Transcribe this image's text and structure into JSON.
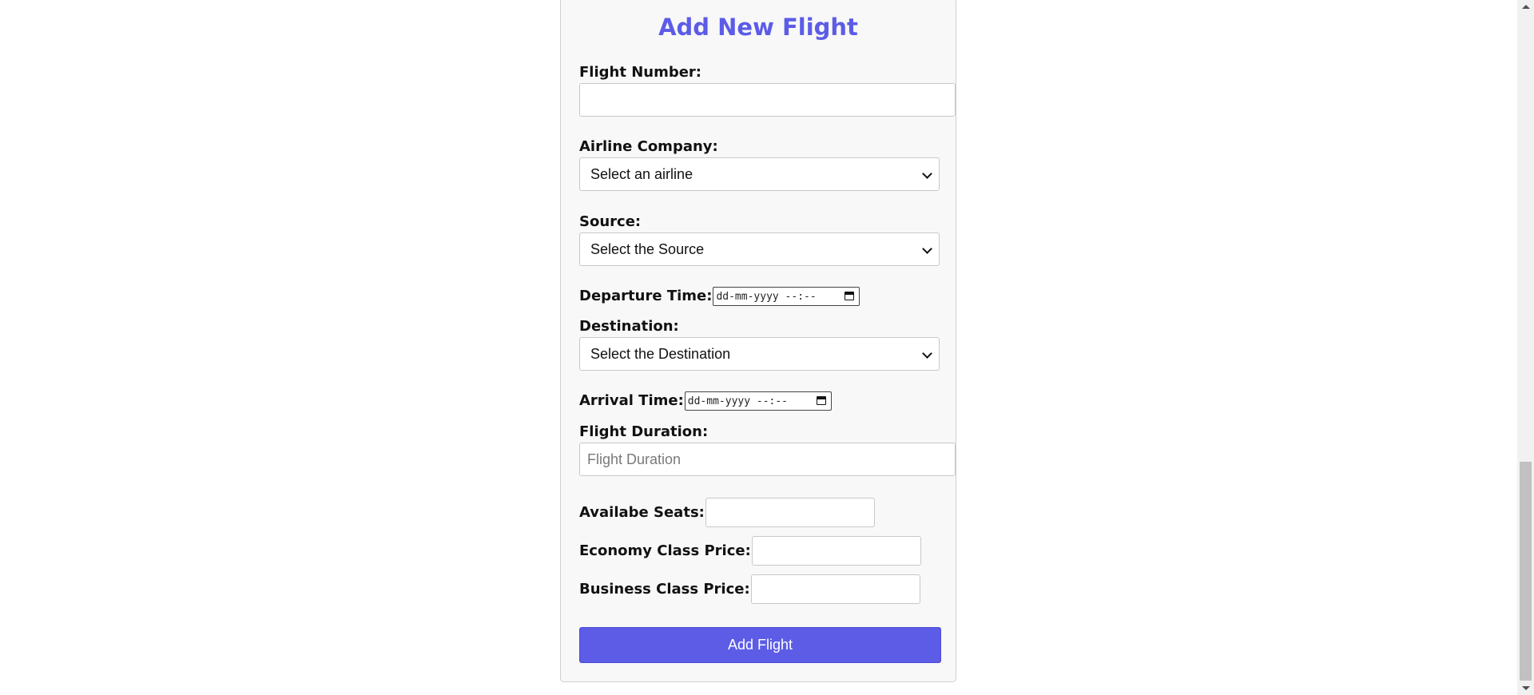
{
  "form": {
    "title": "Add New Flight",
    "flight_number": {
      "label": "Flight Number:",
      "value": ""
    },
    "airline": {
      "label": "Airline Company:",
      "selected": "Select an airline"
    },
    "source": {
      "label": "Source:",
      "selected": "Select the Source"
    },
    "departure": {
      "label": "Departure Time:",
      "value": "dd-mm-yyyy --:--"
    },
    "destination": {
      "label": "Destination:",
      "selected": "Select the Destination"
    },
    "arrival": {
      "label": "Arrival Time:",
      "value": "dd-mm-yyyy --:--"
    },
    "duration": {
      "label": "Flight Duration:",
      "placeholder": "Flight Duration"
    },
    "seats": {
      "label": "Availabe Seats:",
      "value": ""
    },
    "economy_price": {
      "label": "Economy Class Price:",
      "value": ""
    },
    "business_price": {
      "label": "Business Class Price:",
      "value": ""
    },
    "submit_label": "Add Flight"
  },
  "colors": {
    "accent": "#5c5ce7",
    "card_bg": "#f8f8f8"
  },
  "icons": {
    "select_arrow": "chevron-down-icon",
    "date_picker": "calendar-icon"
  },
  "scrollbar": {
    "scroll_fraction": 0.68
  }
}
